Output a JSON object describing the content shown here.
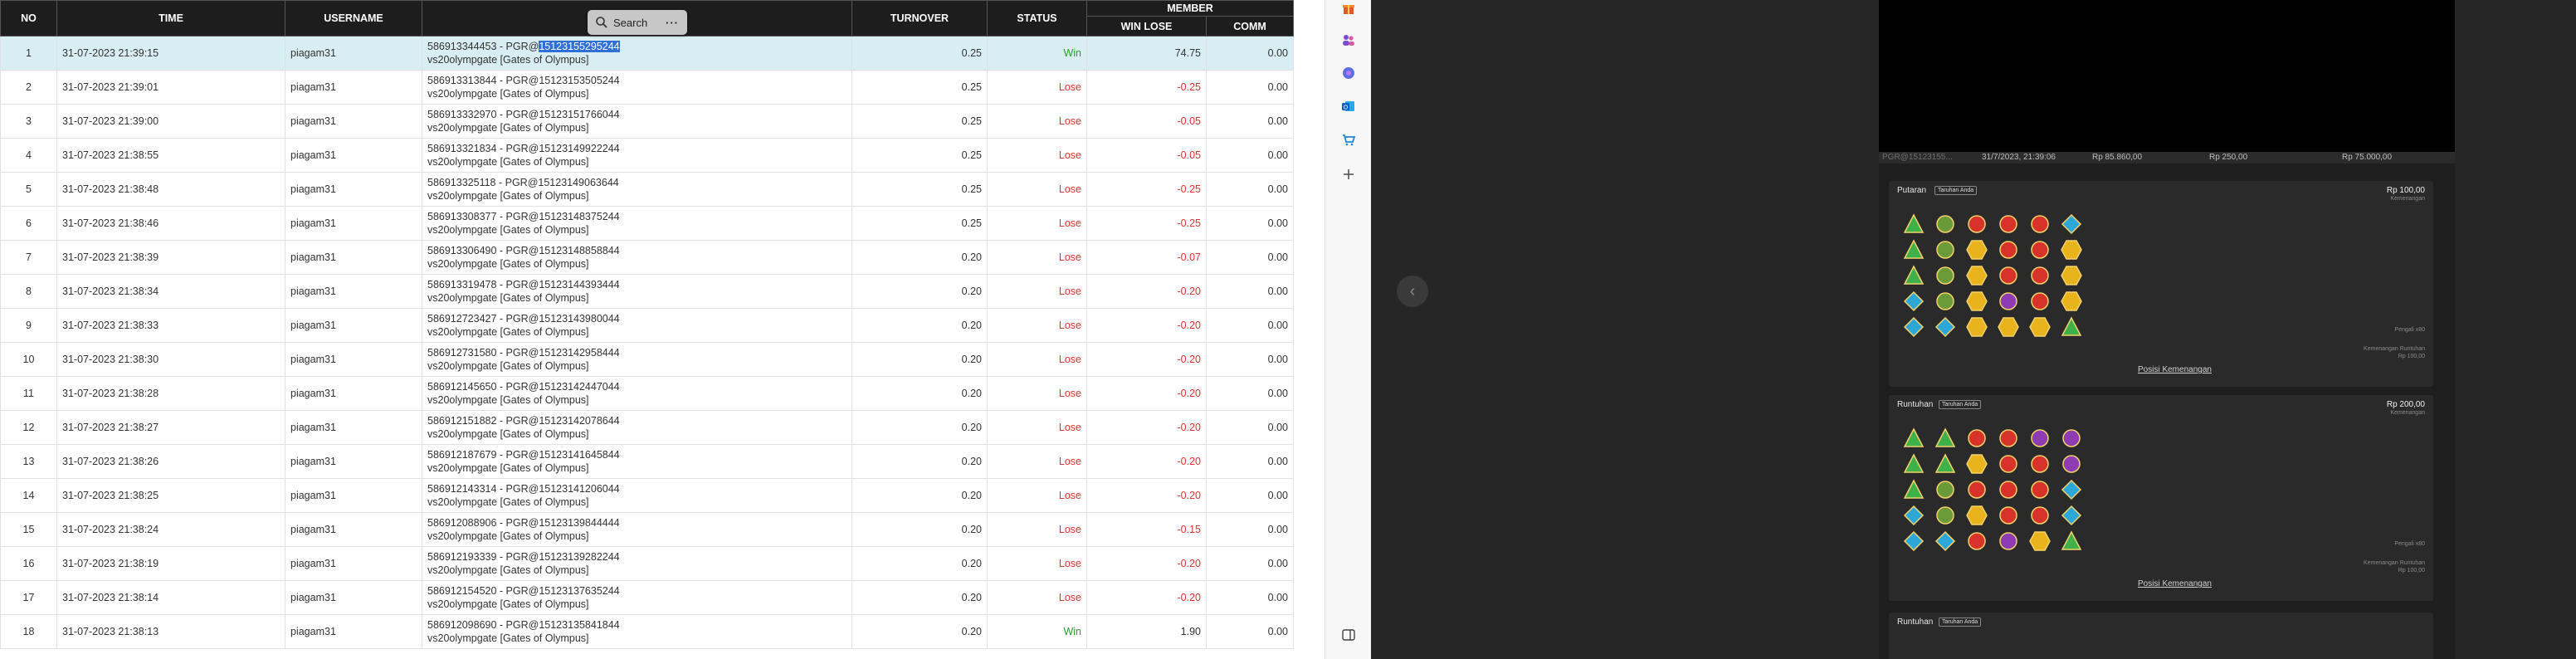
{
  "table": {
    "headers": {
      "no": "NO",
      "time": "TIME",
      "username": "USERNAME",
      "bet": "",
      "turnover": "TURNOVER",
      "status": "STATUS",
      "member": "MEMBER",
      "win_lose": "WIN LOSE",
      "comm": "COMM"
    },
    "rows": [
      {
        "no": "1",
        "time": "31-07-2023 21:39:15",
        "username": "piagam31",
        "bet_prefix": "586913344453 - PGR@",
        "bet_id": "15123155295244",
        "game": "vs20olympgate [Gates of Olympus]",
        "turnover": "0.25",
        "status": "Win",
        "win_lose": "74.75",
        "comm": "0.00"
      },
      {
        "no": "2",
        "time": "31-07-2023 21:39:01",
        "username": "piagam31",
        "bet_prefix": "586913313844 - PGR@",
        "bet_id": "15123153505244",
        "game": "vs20olympgate [Gates of Olympus]",
        "turnover": "0.25",
        "status": "Lose",
        "win_lose": "-0.25",
        "comm": "0.00"
      },
      {
        "no": "3",
        "time": "31-07-2023 21:39:00",
        "username": "piagam31",
        "bet_prefix": "586913332970 - PGR@",
        "bet_id": "15123151766044",
        "game": "vs20olympgate [Gates of Olympus]",
        "turnover": "0.25",
        "status": "Lose",
        "win_lose": "-0.05",
        "comm": "0.00"
      },
      {
        "no": "4",
        "time": "31-07-2023 21:38:55",
        "username": "piagam31",
        "bet_prefix": "586913321834 - PGR@",
        "bet_id": "15123149922244",
        "game": "vs20olympgate [Gates of Olympus]",
        "turnover": "0.25",
        "status": "Lose",
        "win_lose": "-0.05",
        "comm": "0.00"
      },
      {
        "no": "5",
        "time": "31-07-2023 21:38:48",
        "username": "piagam31",
        "bet_prefix": "586913325118 - PGR@",
        "bet_id": "15123149063644",
        "game": "vs20olympgate [Gates of Olympus]",
        "turnover": "0.25",
        "status": "Lose",
        "win_lose": "-0.25",
        "comm": "0.00"
      },
      {
        "no": "6",
        "time": "31-07-2023 21:38:46",
        "username": "piagam31",
        "bet_prefix": "586913308377 - PGR@",
        "bet_id": "15123148375244",
        "game": "vs20olympgate [Gates of Olympus]",
        "turnover": "0.25",
        "status": "Lose",
        "win_lose": "-0.25",
        "comm": "0.00"
      },
      {
        "no": "7",
        "time": "31-07-2023 21:38:39",
        "username": "piagam31",
        "bet_prefix": "586913306490 - PGR@",
        "bet_id": "15123148858844",
        "game": "vs20olympgate [Gates of Olympus]",
        "turnover": "0.20",
        "status": "Lose",
        "win_lose": "-0.07",
        "comm": "0.00"
      },
      {
        "no": "8",
        "time": "31-07-2023 21:38:34",
        "username": "piagam31",
        "bet_prefix": "586913319478 - PGR@",
        "bet_id": "15123144393444",
        "game": "vs20olympgate [Gates of Olympus]",
        "turnover": "0.20",
        "status": "Lose",
        "win_lose": "-0.20",
        "comm": "0.00"
      },
      {
        "no": "9",
        "time": "31-07-2023 21:38:33",
        "username": "piagam31",
        "bet_prefix": "586912723427 - PGR@",
        "bet_id": "15123143980044",
        "game": "vs20olympgate [Gates of Olympus]",
        "turnover": "0.20",
        "status": "Lose",
        "win_lose": "-0.20",
        "comm": "0.00"
      },
      {
        "no": "10",
        "time": "31-07-2023 21:38:30",
        "username": "piagam31",
        "bet_prefix": "586912731580 - PGR@",
        "bet_id": "15123142958444",
        "game": "vs20olympgate [Gates of Olympus]",
        "turnover": "0.20",
        "status": "Lose",
        "win_lose": "-0.20",
        "comm": "0.00"
      },
      {
        "no": "11",
        "time": "31-07-2023 21:38:28",
        "username": "piagam31",
        "bet_prefix": "586912145650 - PGR@",
        "bet_id": "15123142447044",
        "game": "vs20olympgate [Gates of Olympus]",
        "turnover": "0.20",
        "status": "Lose",
        "win_lose": "-0.20",
        "comm": "0.00"
      },
      {
        "no": "12",
        "time": "31-07-2023 21:38:27",
        "username": "piagam31",
        "bet_prefix": "586912151882 - PGR@",
        "bet_id": "15123142078644",
        "game": "vs20olympgate [Gates of Olympus]",
        "turnover": "0.20",
        "status": "Lose",
        "win_lose": "-0.20",
        "comm": "0.00"
      },
      {
        "no": "13",
        "time": "31-07-2023 21:38:26",
        "username": "piagam31",
        "bet_prefix": "586912187679 - PGR@",
        "bet_id": "15123141645844",
        "game": "vs20olympgate [Gates of Olympus]",
        "turnover": "0.20",
        "status": "Lose",
        "win_lose": "-0.20",
        "comm": "0.00"
      },
      {
        "no": "14",
        "time": "31-07-2023 21:38:25",
        "username": "piagam31",
        "bet_prefix": "586912143314 - PGR@",
        "bet_id": "15123141206044",
        "game": "vs20olympgate [Gates of Olympus]",
        "turnover": "0.20",
        "status": "Lose",
        "win_lose": "-0.20",
        "comm": "0.00"
      },
      {
        "no": "15",
        "time": "31-07-2023 21:38:24",
        "username": "piagam31",
        "bet_prefix": "586912088906 - PGR@",
        "bet_id": "15123139844444",
        "game": "vs20olympgate [Gates of Olympus]",
        "turnover": "0.20",
        "status": "Lose",
        "win_lose": "-0.15",
        "comm": "0.00"
      },
      {
        "no": "16",
        "time": "31-07-2023 21:38:19",
        "username": "piagam31",
        "bet_prefix": "586912193339 - PGR@",
        "bet_id": "15123139282244",
        "game": "vs20olympgate [Gates of Olympus]",
        "turnover": "0.20",
        "status": "Lose",
        "win_lose": "-0.20",
        "comm": "0.00"
      },
      {
        "no": "17",
        "time": "31-07-2023 21:38:14",
        "username": "piagam31",
        "bet_prefix": "586912154520 - PGR@",
        "bet_id": "15123137635244",
        "game": "vs20olympgate [Gates of Olympus]",
        "turnover": "0.20",
        "status": "Lose",
        "win_lose": "-0.20",
        "comm": "0.00"
      },
      {
        "no": "18",
        "time": "31-07-2023 21:38:13",
        "username": "piagam31",
        "bet_prefix": "586912098690 - PGR@",
        "bet_id": "15123135841844",
        "game": "vs20olympgate [Gates of Olympus]",
        "turnover": "0.20",
        "status": "Win",
        "win_lose": "1.90",
        "comm": "0.00"
      }
    ]
  },
  "search_popup": {
    "label": "Search",
    "more": "···"
  },
  "sidebar": {
    "icons": [
      "gift-icon",
      "people-icon",
      "copilot-icon",
      "outlook-icon",
      "shopping-icon",
      "add-icon",
      "sidebar-toggle-icon"
    ]
  },
  "game_history": {
    "summary": {
      "round": "PGR@15123155...",
      "datetime": "31/7/2023, 21:39:06",
      "balance": "Rp 85.860,00",
      "bet": "Rp 250,00",
      "win": "Rp 75.000,00"
    },
    "cards": [
      {
        "title": "Putaran",
        "tag": "Taruhan Anda",
        "amount": "Rp 100,00",
        "amount_label": "Kemenangan",
        "caption1": "Pengali x80",
        "caption2": "Kemenangan Runtuhan",
        "caption3": "Rp 100,00",
        "link": "Posisi Kemenangan",
        "grid": [
          [
            "g",
            "o",
            "r",
            "r",
            "r",
            "b"
          ],
          [
            "g",
            "o",
            "y",
            "r",
            "r",
            "y"
          ],
          [
            "g",
            "o",
            "y",
            "r",
            "r",
            "y"
          ],
          [
            "b",
            "o",
            "y",
            "p",
            "r",
            "y"
          ],
          [
            "b",
            "b",
            "y",
            "y",
            "y",
            "g"
          ]
        ]
      },
      {
        "title": "Runtuhan",
        "tag": "Taruhan Anda",
        "amount": "Rp 200,00",
        "amount_label": "Kemenangan",
        "caption1": "Pengali x80",
        "caption2": "Kemenangan Runtuhan",
        "caption3": "Rp 100,00",
        "link": "Posisi Kemenangan",
        "grid": [
          [
            "g",
            "g",
            "r",
            "r",
            "p",
            "p"
          ],
          [
            "g",
            "g",
            "y",
            "r",
            "r",
            "p"
          ],
          [
            "g",
            "o",
            "r",
            "r",
            "r",
            "b"
          ],
          [
            "b",
            "o",
            "y",
            "r",
            "r",
            "b"
          ],
          [
            "b",
            "b",
            "r",
            "p",
            "y",
            "g"
          ]
        ]
      },
      {
        "title": "Runtuhan",
        "tag": "Taruhan Anda"
      }
    ]
  },
  "colors": {
    "header_bg": "#1d1d1d",
    "highlight_row": "#d8eef3",
    "win": "#2a9d2a",
    "lose": "#e03131",
    "selection": "#2f6fd9",
    "game_bg": "#1e1e1e",
    "card_bg": "#2a2a2a"
  }
}
